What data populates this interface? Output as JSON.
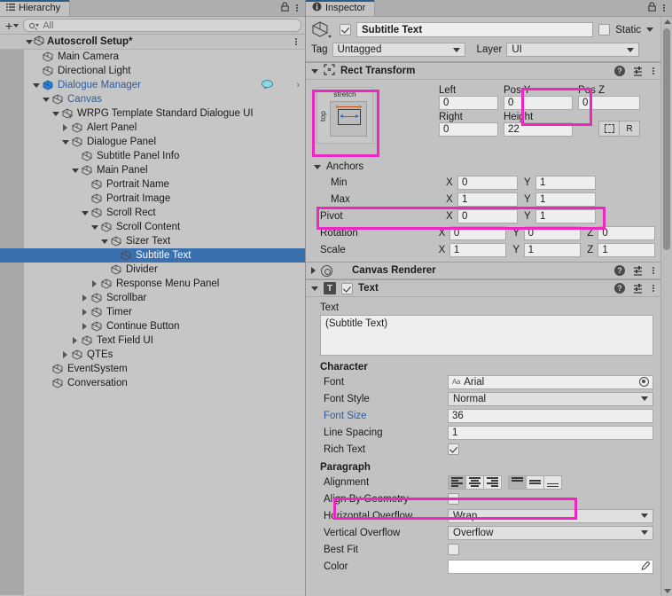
{
  "hierarchy": {
    "tab_label": "Hierarchy",
    "tab_icon": "hierarchy-icon",
    "lock_icon": "lock-icon",
    "menu_icon": "kebab-menu-icon",
    "toolbar": {
      "add_label": "+",
      "search_placeholder": "All",
      "search_value": ""
    },
    "scene": {
      "label": "Autoscroll Setup*",
      "icon": "unity-scene-icon"
    },
    "items": [
      {
        "label": "Main Camera",
        "depth": 2,
        "toggle": "none",
        "color": "dark"
      },
      {
        "label": "Directional Light",
        "depth": 2,
        "toggle": "none",
        "color": "dark"
      },
      {
        "label": "Dialogue Manager",
        "depth": 2,
        "toggle": "down",
        "color": "blue",
        "prefab": true,
        "badge": "dialogue-icon",
        "chevron": true
      },
      {
        "label": "Canvas",
        "depth": 3,
        "toggle": "down",
        "color": "blue"
      },
      {
        "label": "WRPG Template Standard Dialogue UI",
        "depth": 4,
        "toggle": "down",
        "color": "dark",
        "added": true
      },
      {
        "label": "Alert Panel",
        "depth": 5,
        "toggle": "right",
        "color": "dark"
      },
      {
        "label": "Dialogue Panel",
        "depth": 5,
        "toggle": "down",
        "color": "dark"
      },
      {
        "label": "Subtitle Panel Info",
        "depth": 6,
        "toggle": "none",
        "color": "dark"
      },
      {
        "label": "Main Panel",
        "depth": 6,
        "toggle": "down",
        "color": "dark"
      },
      {
        "label": "Portrait Name",
        "depth": 7,
        "toggle": "none",
        "color": "dark"
      },
      {
        "label": "Portrait Image",
        "depth": 7,
        "toggle": "none",
        "color": "dark"
      },
      {
        "label": "Scroll Rect",
        "depth": 7,
        "toggle": "down",
        "color": "dark"
      },
      {
        "label": "Scroll Content",
        "depth": 8,
        "toggle": "down",
        "color": "dark"
      },
      {
        "label": "Sizer Text",
        "depth": 9,
        "toggle": "down",
        "color": "dark"
      },
      {
        "label": "Subtitle Text",
        "depth": 10,
        "toggle": "none",
        "color": "dark",
        "selected": true
      },
      {
        "label": "Divider",
        "depth": 9,
        "toggle": "none",
        "color": "dark"
      },
      {
        "label": "Response Menu Panel",
        "depth": 8,
        "toggle": "right",
        "color": "dark"
      },
      {
        "label": "Scrollbar",
        "depth": 7,
        "toggle": "right",
        "color": "dark"
      },
      {
        "label": "Timer",
        "depth": 7,
        "toggle": "right",
        "color": "dark"
      },
      {
        "label": "Continue Button",
        "depth": 7,
        "toggle": "right",
        "color": "dark"
      },
      {
        "label": "Text Field UI",
        "depth": 6,
        "toggle": "right",
        "color": "dark"
      },
      {
        "label": "QTEs",
        "depth": 5,
        "toggle": "right",
        "color": "dark"
      },
      {
        "label": "EventSystem",
        "depth": 3,
        "toggle": "none",
        "color": "dark"
      },
      {
        "label": "Conversation",
        "depth": 3,
        "toggle": "none",
        "color": "dark"
      }
    ]
  },
  "inspector": {
    "tab_label": "Inspector",
    "tab_icon": "info-icon",
    "lock_icon": "lock-icon",
    "menu_icon": "kebab-menu-icon",
    "game_object": {
      "enabled": true,
      "name": "Subtitle Text",
      "static_label": "Static",
      "static_checked": false,
      "tag_label": "Tag",
      "tag_value": "Untagged",
      "layer_label": "Layer",
      "layer_value": "UI"
    },
    "rect_transform": {
      "title": "Rect Transform",
      "expanded": true,
      "anchor_preset": {
        "top_label": "stretch",
        "side_label": "top"
      },
      "left_label": "Left",
      "left_value": "0",
      "posy_label": "Pos Y",
      "posy_value": "0",
      "posz_label": "Pos Z",
      "posz_value": "0",
      "right_label": "Right",
      "right_value": "0",
      "height_label": "Height",
      "height_value": "22",
      "blueprint_button": "blueprint-mode-icon",
      "raw_button": "R",
      "anchors_label": "Anchors",
      "min_label": "Min",
      "min_x": "0",
      "min_y": "1",
      "max_label": "Max",
      "max_x": "1",
      "max_y": "1",
      "pivot_label": "Pivot",
      "pivot_x": "0",
      "pivot_y": "1",
      "rotation_label": "Rotation",
      "rot_x": "0",
      "rot_y": "0",
      "rot_z": "0",
      "scale_label": "Scale",
      "scale_x": "1",
      "scale_y": "1",
      "scale_z": "1",
      "axis_x": "X",
      "axis_y": "Y",
      "axis_z": "Z"
    },
    "canvas_renderer": {
      "title": "Canvas Renderer",
      "expanded": false
    },
    "text_component": {
      "title": "Text",
      "enabled": true,
      "expanded": true,
      "text_label": "Text",
      "text_value": "(Subtitle Text)",
      "character_label": "Character",
      "font_label": "Font",
      "font_value": "Arial",
      "font_style_label": "Font Style",
      "font_style_value": "Normal",
      "font_size_label": "Font Size",
      "font_size_value": "36",
      "line_spacing_label": "Line Spacing",
      "line_spacing_value": "1",
      "rich_text_label": "Rich Text",
      "rich_text_checked": true,
      "paragraph_label": "Paragraph",
      "alignment_label": "Alignment",
      "alignment_horizontal": "left",
      "alignment_vertical": "top",
      "align_geometry_label": "Align By Geometry",
      "align_geometry_checked": false,
      "h_overflow_label": "Horizontal Overflow",
      "h_overflow_value": "Wrap",
      "v_overflow_label": "Vertical Overflow",
      "v_overflow_value": "Overflow",
      "best_fit_label": "Best Fit",
      "best_fit_checked": false,
      "color_label": "Color",
      "color_value": "#FFFFFF"
    }
  },
  "annotations": {
    "highlight_color": "#ee27c0",
    "boxes": [
      {
        "name": "anchor-preset-highlight"
      },
      {
        "name": "pos-y-highlight"
      },
      {
        "name": "pivot-row-highlight"
      },
      {
        "name": "alignment-highlight"
      }
    ]
  }
}
